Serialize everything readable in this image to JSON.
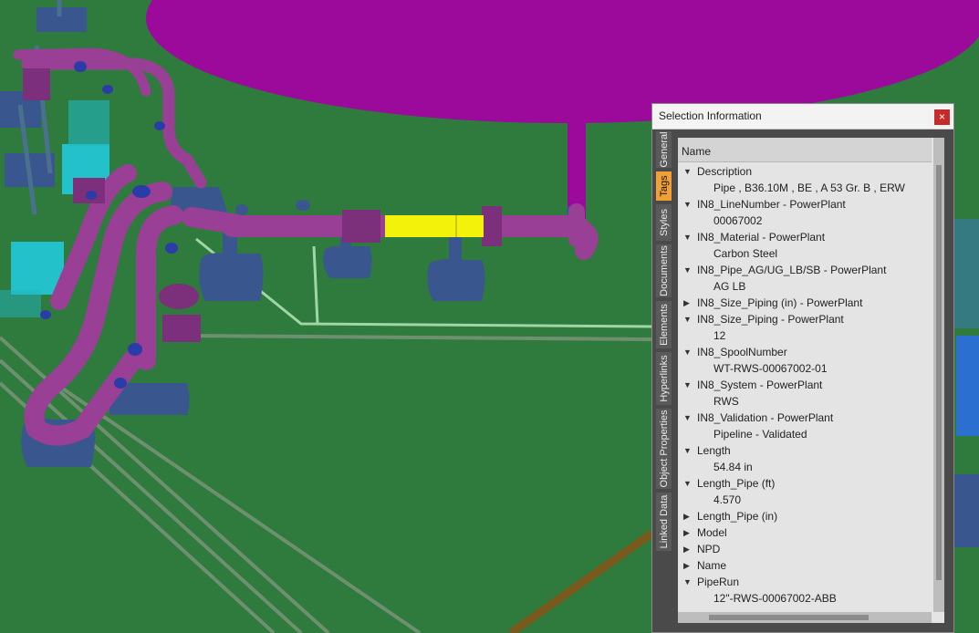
{
  "panel": {
    "title": "Selection Information",
    "close_glyph": "×",
    "tabs": [
      "General",
      "Tags",
      "Styles",
      "Documents",
      "Elements",
      "Hyperlinks",
      "Object Properties",
      "Linked Data"
    ],
    "active_tab": "Tags",
    "column_header": "Name",
    "properties": [
      {
        "label": "Description",
        "expanded": true,
        "value": "Pipe , B36.10M , BE , A 53 Gr. B , ERW"
      },
      {
        "label": "IN8_LineNumber - PowerPlant",
        "expanded": true,
        "value": "00067002"
      },
      {
        "label": "IN8_Material - PowerPlant",
        "expanded": true,
        "value": "Carbon Steel"
      },
      {
        "label": "IN8_Pipe_AG/UG_LB/SB - PowerPlant",
        "expanded": true,
        "value": "AG LB"
      },
      {
        "label": "IN8_Size_Piping (in) - PowerPlant",
        "expanded": false
      },
      {
        "label": "IN8_Size_Piping - PowerPlant",
        "expanded": true,
        "value": "12"
      },
      {
        "label": "IN8_SpoolNumber",
        "expanded": true,
        "value": "WT-RWS-00067002-01"
      },
      {
        "label": "IN8_System - PowerPlant",
        "expanded": true,
        "value": "RWS"
      },
      {
        "label": "IN8_Validation - PowerPlant",
        "expanded": true,
        "value": "Pipeline - Validated"
      },
      {
        "label": "Length",
        "expanded": true,
        "value": "54.84 in"
      },
      {
        "label": "Length_Pipe (ft)",
        "expanded": true,
        "value": "4.570"
      },
      {
        "label": "Length_Pipe (in)",
        "expanded": false
      },
      {
        "label": "Model",
        "expanded": false
      },
      {
        "label": "NPD",
        "expanded": false
      },
      {
        "label": "Name",
        "expanded": false
      },
      {
        "label": "PipeRun",
        "expanded": true,
        "value": "12\"-RWS-00067002-ABB"
      }
    ]
  },
  "colors": {
    "ground": "#2f7a3d",
    "tank": "#9c0a9c",
    "pipe": "#9a3f96",
    "selected_pipe": "#f2f20a",
    "support": "#3a568f",
    "equipment": "#22c9d9",
    "tab_active": "#f0a035"
  }
}
